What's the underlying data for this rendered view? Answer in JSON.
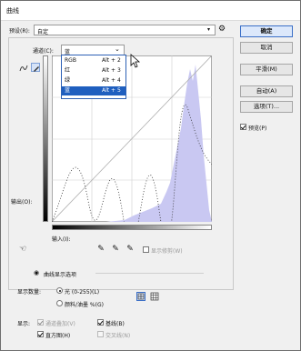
{
  "dialog": {
    "title": "曲线"
  },
  "preset": {
    "label": "预设(R):",
    "value": "自定",
    "gear_icon": "gear-icon"
  },
  "channel": {
    "label": "通道(C):",
    "value": "蓝"
  },
  "channel_menu": {
    "items": [
      {
        "name": "RGB",
        "shortcut": "Alt + 2"
      },
      {
        "name": "红",
        "shortcut": "Alt + 3"
      },
      {
        "name": "绿",
        "shortcut": "Alt + 4"
      },
      {
        "name": "蓝",
        "shortcut": "Alt + 5",
        "selected": true
      }
    ]
  },
  "buttons": {
    "ok": "确定",
    "cancel": "取消",
    "smooth": "平滑(M)",
    "auto": "自动(A)",
    "options": "选项(T)..."
  },
  "preview": {
    "label": "预览(P)",
    "checked": true
  },
  "graph": {
    "output_label": "输出(O):",
    "input_label": "输入(I):",
    "histogram_color": "#c9c8f2",
    "curve_line_color": "#111111"
  },
  "show_clipping": {
    "label": "显示修剪(W)",
    "checked": false
  },
  "curve_display_options": {
    "label": "曲线显示选项"
  },
  "show_amount": {
    "label": "显示数量:",
    "options": [
      {
        "label": "光 (0-255)(L)",
        "selected": true
      },
      {
        "label": "颜料/油墨 %(G)",
        "selected": false
      }
    ]
  },
  "show": {
    "label": "显示:",
    "items": [
      {
        "label": "通道叠加(V)",
        "checked": true,
        "disabled": true
      },
      {
        "label": "基线(B)",
        "checked": true,
        "disabled": false
      },
      {
        "label": "直方图(H)",
        "checked": true,
        "disabled": false
      },
      {
        "label": "交叉线(N)",
        "checked": false,
        "disabled": true
      }
    ]
  }
}
